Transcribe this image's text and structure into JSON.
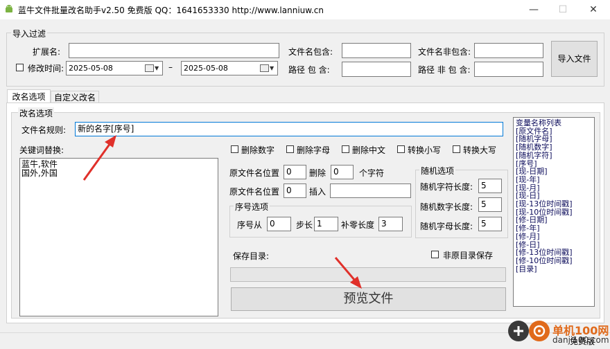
{
  "window": {
    "title": "蓝牛文件批量改名助手v2.50 免费版  QQ：1641653330  http://www.lanniuw.cn",
    "min_symbol": "—",
    "max_symbol": "☐",
    "close_symbol": "✕"
  },
  "import_filter": {
    "group_label": "导入过滤",
    "ext_label": "扩展名:",
    "ext_value": "",
    "modified_label": "修改时间:",
    "date_from": "2025-05-08",
    "date_sep": "–",
    "date_to": "2025-05-08",
    "name_contains_label": "文件名包含:",
    "name_contains_value": "",
    "name_excludes_label": "文件名非包含:",
    "name_excludes_value": "",
    "path_contains_label": "路径 包 含:",
    "path_contains_value": "",
    "path_excludes_label": "路径 非 包 含:",
    "path_excludes_value": "",
    "import_button": "导入文件"
  },
  "tabs": [
    {
      "label": "改名选项",
      "active": true
    },
    {
      "label": "自定义改名",
      "active": false
    }
  ],
  "rename": {
    "group_label": "改名选项",
    "rule_label": "文件名规则:",
    "rule_value": "新的名字[序号]",
    "keyword_label": "关键词替换:",
    "keyword_lines": [
      "蓝牛,软件",
      "国外,外国"
    ],
    "options": [
      "删除数字",
      "删除字母",
      "删除中文",
      "转换小写",
      "转换大写"
    ],
    "pos_label_1": "原文件名位置",
    "pos_value_1": "0",
    "delete_label": "删除",
    "delete_value": "0",
    "chars_label": "个字符",
    "pos_label_2": "原文件名位置",
    "pos_value_2": "0",
    "insert_label": "插入",
    "insert_value": "",
    "seq_group_label": "序号选项",
    "seq_from_label": "序号从",
    "seq_from_value": "0",
    "step_label": "步长",
    "step_value": "1",
    "pad_label": "补零长度",
    "pad_value": "3",
    "random_group_label": "随机选项",
    "rand_char_label": "随机字符长度:",
    "rand_char_value": "5",
    "rand_num_label": "随机数字长度:",
    "rand_num_value": "5",
    "rand_letter_label": "随机字母长度:",
    "rand_letter_value": "5",
    "save_dir_label": "保存目录:",
    "save_dir_value": "",
    "non_original_label": "非原目录保存",
    "preview_button": "预览文件"
  },
  "var_list": {
    "title": "变量名称列表",
    "items": [
      "[原文件名]",
      "[随机字母]",
      "[随机数字]",
      "[随机字符]",
      "[序号]",
      "[现-日期]",
      "[现-年]",
      "[现-月]",
      "[现-日]",
      "[现-13位时间戳]",
      "[现-10位时间戳]",
      "[修-日期]",
      "[修-年]",
      "[修-月]",
      "[修-日]",
      "[修-13位时间戳]",
      "[修-10位时间戳]",
      "[目录]"
    ]
  },
  "status": {
    "edition": "免费版"
  },
  "watermark": {
    "text": "单机100网",
    "url": "danji100.com"
  },
  "colors": {
    "accent_arrow": "#e0302a",
    "focus_border": "#0078d7",
    "watermark": "#e06a1b"
  }
}
